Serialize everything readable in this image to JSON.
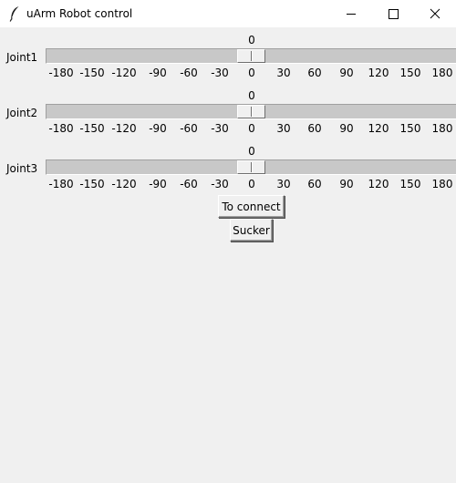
{
  "window": {
    "title": "uArm Robot control",
    "app_icon": "feather-icon",
    "controls": [
      "minimize-icon",
      "maximize-icon",
      "close-icon"
    ]
  },
  "joints": [
    {
      "label": "Joint1",
      "value": "0"
    },
    {
      "label": "Joint2",
      "value": "0"
    },
    {
      "label": "Joint3",
      "value": "0"
    }
  ],
  "scale": {
    "from": -180,
    "to": 180,
    "ticks": [
      "-180",
      "-150",
      "-120",
      "-90",
      "-60",
      "-30",
      "0",
      "30",
      "60",
      "90",
      "120",
      "150",
      "180"
    ]
  },
  "buttons": {
    "connect_label": "To connect",
    "sucker_label": "Sucker"
  }
}
